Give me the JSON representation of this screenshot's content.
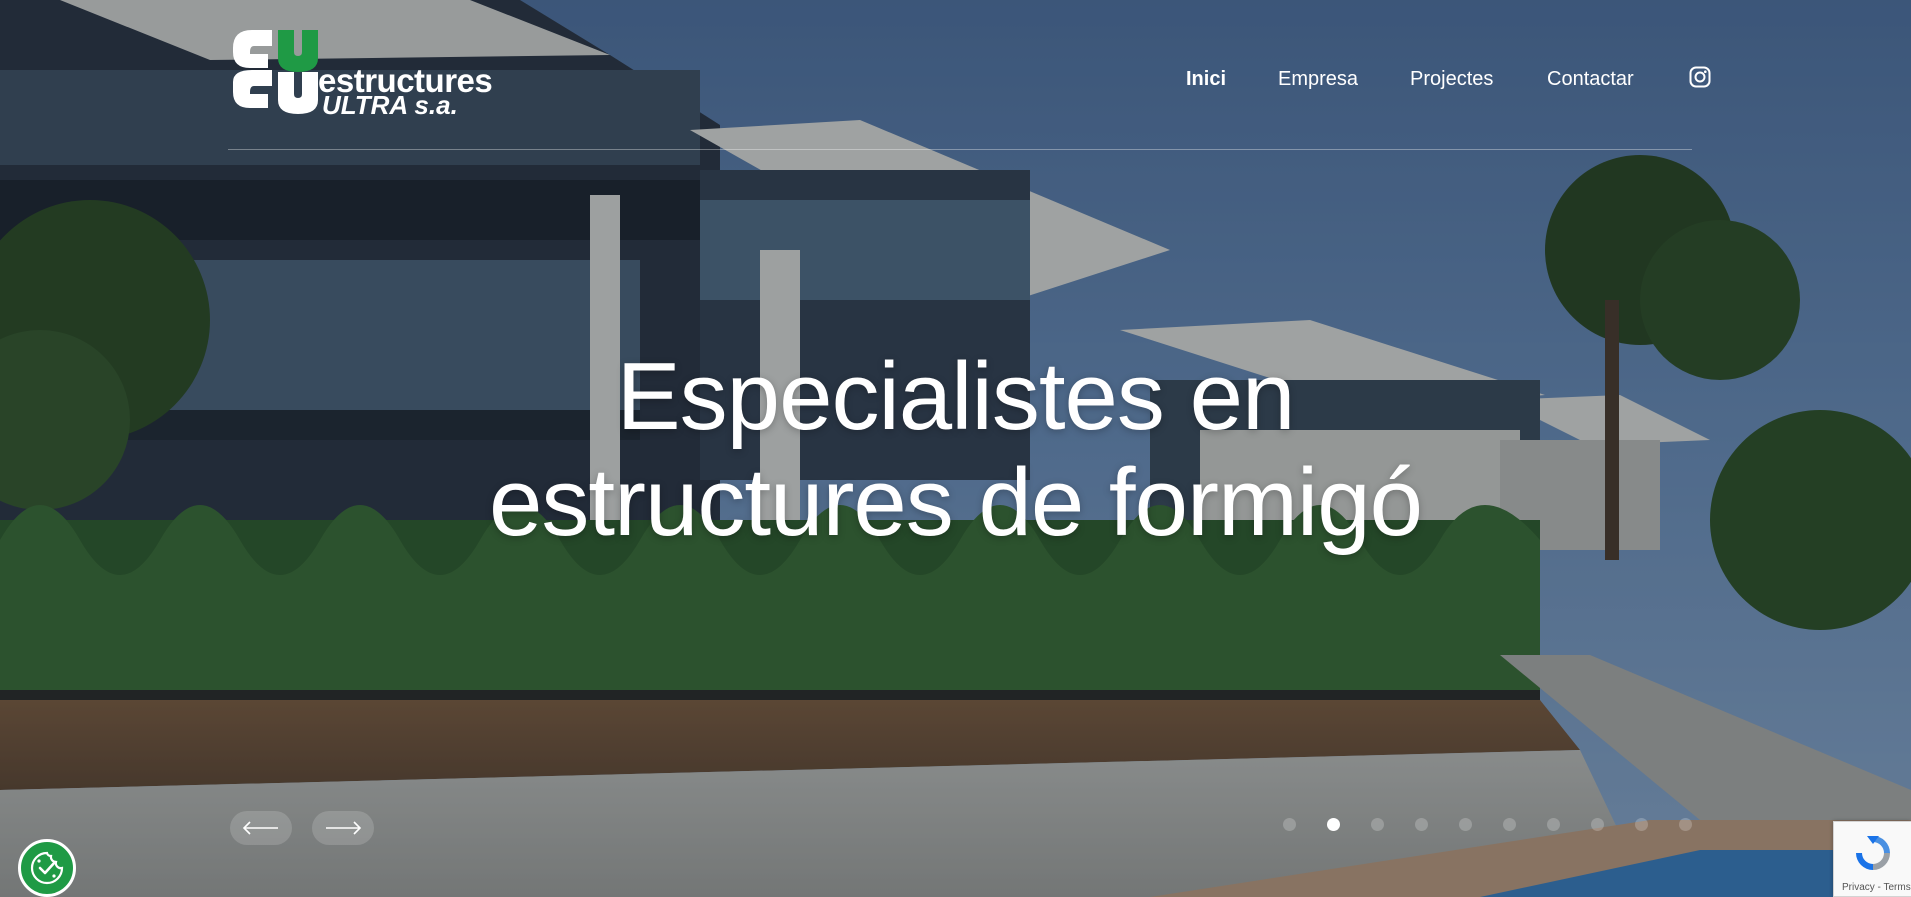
{
  "brand": {
    "name_line_1": "estructures",
    "name_line_2": "ULTRA s.a.",
    "logo_color": "#ffffff"
  },
  "nav": {
    "items": [
      {
        "label": "Inici",
        "active": true
      },
      {
        "label": "Empresa",
        "active": false
      },
      {
        "label": "Projectes",
        "active": false
      },
      {
        "label": "Contactar",
        "active": false
      }
    ],
    "social_icon": "instagram-icon"
  },
  "hero": {
    "headline_line_1": "Especialistes en",
    "headline_line_2": "estructures de formigó",
    "slide_count": 10,
    "active_slide": 2
  },
  "slider": {
    "prev_icon": "arrow-left-icon",
    "next_icon": "arrow-right-icon"
  },
  "cookie": {
    "icon": "cookie-settings-icon",
    "accent": "#1f9a45"
  },
  "recaptcha": {
    "links": "Privacy - Terms"
  },
  "colors": {
    "text": "#ffffff",
    "sky": "#5a7aa5",
    "foliage": "#2f5a2a"
  }
}
